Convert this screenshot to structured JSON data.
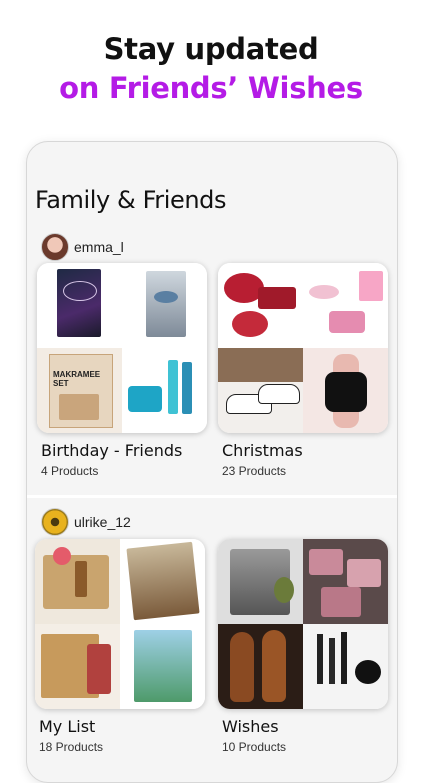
{
  "header": {
    "line1": "Stay updated",
    "line2": "on Friends’ Wishes",
    "accent_color": "#b41be6"
  },
  "section": {
    "title": "Family & Friends"
  },
  "users": [
    {
      "name": "emma_l",
      "avatar_icon": "avatar-photo",
      "lists": [
        {
          "title": "Birthday - Friends",
          "count": "4 Products"
        },
        {
          "title": "Christmas",
          "count": "23 Products"
        }
      ]
    },
    {
      "name": "ulrike_12",
      "avatar_icon": "avatar-sunflower",
      "lists": [
        {
          "title": "My List",
          "count": "18 Products"
        },
        {
          "title": "Wishes",
          "count": "10 Products"
        }
      ]
    }
  ],
  "product_tiles": {
    "birthday": [
      "book-your-heart",
      "book-eye-cover",
      "makramee-set",
      "skincare-products"
    ],
    "christmas": [
      "baking-pans",
      "pink-baking-set",
      "sneakers",
      "smart-watch"
    ],
    "mylist": [
      "gift-box",
      "book-cover",
      "body-shop-box",
      "book-cover-2"
    ],
    "wishes": [
      "espresso-machine",
      "soap-bars",
      "leather-shoes",
      "makeup-brushes"
    ]
  },
  "visible_text_in_images": {
    "makramee": "MAKRAMEE SET"
  }
}
